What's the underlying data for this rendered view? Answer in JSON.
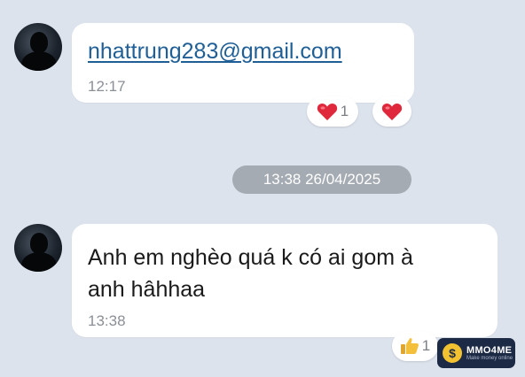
{
  "messages": [
    {
      "text": "nhattrung283@gmail.com",
      "time": "12:17",
      "reactions": {
        "summary_count": "1",
        "summary_icon": "heart-icon",
        "quick_icon": "heart-icon"
      }
    },
    {
      "text_line1": "Anh em nghèo quá k có ai gom à",
      "text_line2": "anh hâhhaa",
      "time": "13:38",
      "reactions": {
        "summary_count": "1",
        "summary_icon": "thumbs-up-icon"
      }
    }
  ],
  "date_separator": "13:38 26/04/2025",
  "watermark": {
    "brand": "MMO4ME",
    "tagline": "Make money online",
    "coin_symbol": "$"
  },
  "colors": {
    "background": "#dde3ec",
    "link": "#1f5f96",
    "heart": "#e0283c",
    "date_pill": "#a5abb3"
  }
}
